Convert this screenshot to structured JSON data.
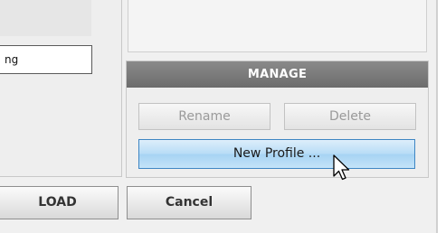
{
  "profile_field": {
    "value": "ng"
  },
  "manage": {
    "title": "MANAGE",
    "rename_label": "Rename",
    "delete_label": "Delete",
    "new_profile_label": "New Profile ..."
  },
  "actions": {
    "load_label": "LOAD",
    "cancel_label": "Cancel"
  },
  "colors": {
    "header_gray": "#7a7a7a",
    "highlight_blue": "#b7dcf6",
    "highlight_border": "#3f86c3",
    "disabled_text": "#9a9a9a"
  },
  "icons": {
    "pointer": "arrow-cursor-icon"
  }
}
